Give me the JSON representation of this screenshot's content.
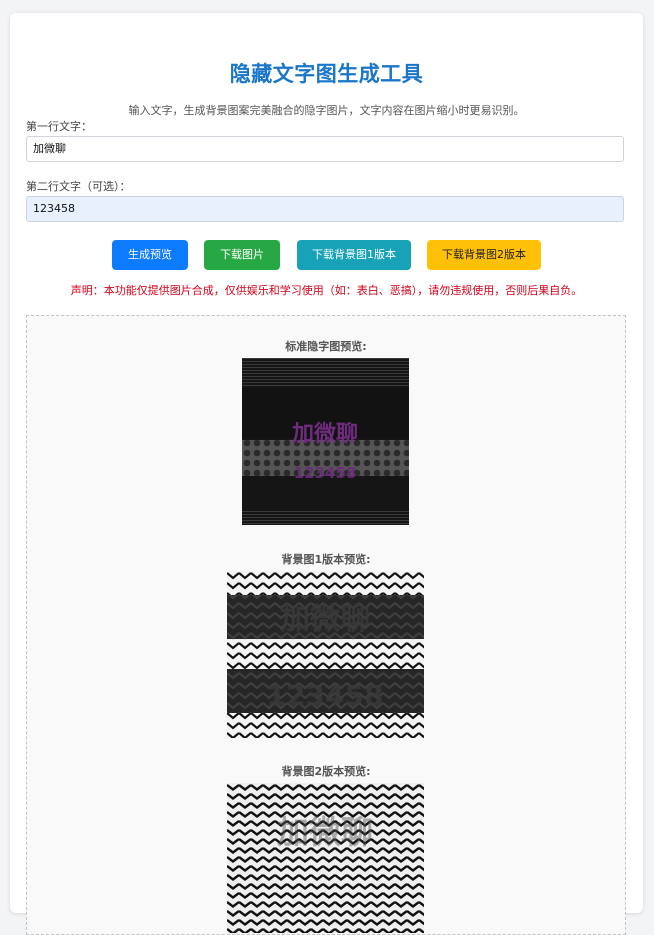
{
  "app": {
    "title": "隐藏文字图生成工具",
    "subtitle": "输入文字，生成背景图案完美融合的隐字图片，文字内容在图片缩小时更易识别。"
  },
  "form": {
    "line1_label": "第一行文字：",
    "line1_value": "加微聊",
    "line2_label": "第二行文字（可选）：",
    "line2_value": "123458"
  },
  "buttons": {
    "generate": "生成预览",
    "download": "下载图片",
    "download_bg1": "下载背景图1版本",
    "download_bg2": "下载背景图2版本"
  },
  "notice": "声明：本功能仅提供图片合成，仅供娱乐和学习使用（如：表白、恶搞），请勿违规使用，否则后果自负。",
  "previews": {
    "standard_label": "标准隐字图预览:",
    "bg1_label": "背景图1版本预览:",
    "bg2_label": "背景图2版本预览:"
  },
  "colors": {
    "title": "#1a76c8",
    "btn_generate": "#0d7bff",
    "btn_download": "#28a745",
    "btn_bg1": "#17a2b8",
    "btn_bg2": "#ffc107",
    "notice": "#d0021b",
    "hidden_text_purple": "#7a2f8a"
  }
}
